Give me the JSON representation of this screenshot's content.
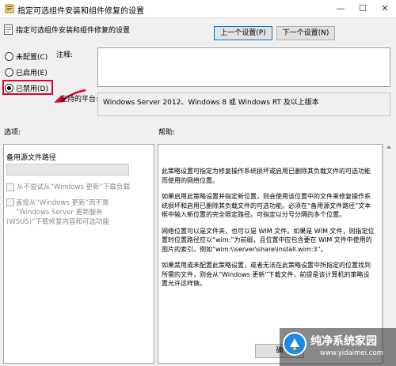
{
  "window": {
    "title": "指定可选组件安装和组件修复的设置",
    "controls": {
      "minimize": "—",
      "maximize": "☐",
      "close": "✕"
    }
  },
  "header": {
    "title": "指定可选组件安装和组件修复的设置",
    "prev_button": "上一个设置(P)",
    "next_button": "下一个设置(N)"
  },
  "options": {
    "not_configured": "未配置(C)",
    "enabled": "已启用(E)",
    "disabled": "已禁用(D)",
    "selected": "disabled"
  },
  "comment": {
    "label": "注释:",
    "value": ""
  },
  "supported": {
    "label": "支持的平台:",
    "value": "Windows Server 2012、Windows 8 或 Windows RT 及以上版本"
  },
  "sections": {
    "options_label": "选项:",
    "help_label": "帮助:"
  },
  "options_panel": {
    "alt_path_label": "备用源文件路径",
    "alt_path_value": "",
    "never_download": "从不尝试从“Windows 更新”下载负载",
    "direct_download_line1": "直接从“Windows 更新”而不是",
    "direct_download_line2": "“Windows Server 更新服务",
    "direct_download_line3": "(WSUS)”下载修复内容和可选功能"
  },
  "help": {
    "p1": "此策略设置可指定为修复操作系统损坏或启用已删除其负载文件的可选功能而使用的网络位置。",
    "p2": "如果启用此策略设置并指定新位置，则会使用该位置中的文件来修复操作系统损坏和启用已删除其负载文件的可选功能。必须在“备用源文件路径”文本框中输入新位置的完全限定路径。可指定以分号分隔的多个位置。",
    "p3": "网络位置可以是文件夹，也可以是 WIM 文件。如果是 WIM 文件，则指定位置时位置路径应以“wim:”为前缀，且位置中应包含要在 WIM 文件中使用的图片的索引。例如“wim:\\\\server\\share\\install.wim:3”。",
    "p4": "如果禁用或未配置此策略设置，或者无法在此策略设置中所指定的位置找到所需的文件，则会从“Windows 更新”下载文件，前提是该计算机的策略设置允许这样做。"
  },
  "footer": {
    "ok_button": "确"
  },
  "watermark": {
    "brand": "纯净系统家园",
    "url": "www.yidaimei.com"
  },
  "colors": {
    "highlight": "#e4002b",
    "accent": "#0078d7"
  }
}
